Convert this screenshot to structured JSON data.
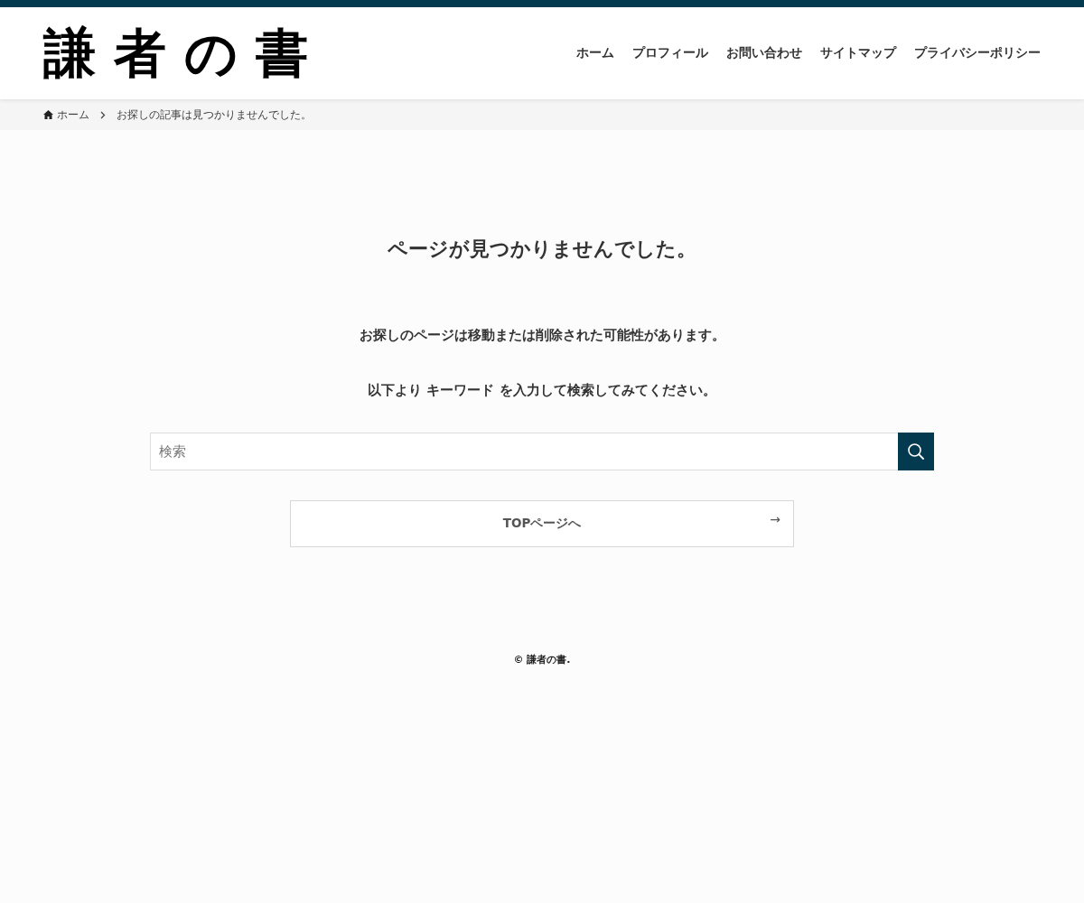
{
  "header": {
    "logo": "謙者の書",
    "nav": [
      {
        "label": "ホーム"
      },
      {
        "label": "プロフィール"
      },
      {
        "label": "お問い合わせ"
      },
      {
        "label": "サイトマップ"
      },
      {
        "label": "プライバシーポリシー"
      }
    ]
  },
  "breadcrumb": [
    {
      "label": "ホーム",
      "kind": "link"
    },
    {
      "label": "お探しの記事は見つかりませんでした。",
      "kind": "current"
    }
  ],
  "main": {
    "title": "ページが見つかりませんでした。",
    "paragraphs": [
      "お探しのページは移動または削除された可能性があります。",
      "以下より キーワード を入力して検索してみてください。"
    ],
    "search": {
      "placeholder": "検索"
    },
    "top_button": {
      "label": "TOPページへ",
      "arrow": "→"
    }
  },
  "footer": {
    "copyright": "© 謙者の書."
  }
}
